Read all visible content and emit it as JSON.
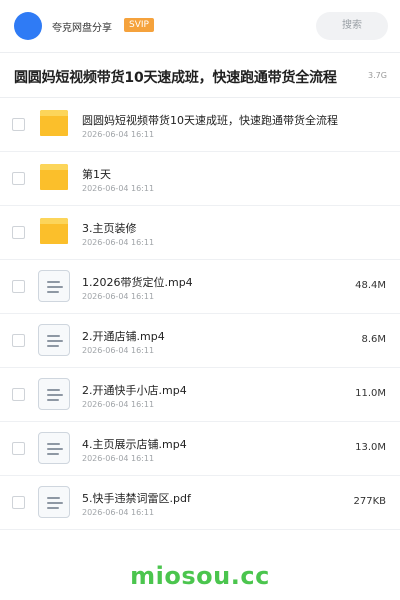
{
  "header": {
    "app_name": "夸克网盘分享",
    "badge": "SVIP",
    "search_label": "搜索"
  },
  "share": {
    "title": "圆圆妈短视频带货10天速成班，快速跑通带货全流程",
    "total_size": "3.7G"
  },
  "files": [
    {
      "type": "folder",
      "name": "圆圆妈短视频带货10天速成班，快速跑通带货全流程",
      "date": "2026-06-04 16:11",
      "size": ""
    },
    {
      "type": "folder",
      "name": "第1天",
      "date": "2026-06-04 16:11",
      "size": ""
    },
    {
      "type": "folder",
      "name": "3.主页装修",
      "date": "2026-06-04 16:11",
      "size": ""
    },
    {
      "type": "file",
      "name": "1.2026带货定位.mp4",
      "date": "2026-06-04 16:11",
      "size": "48.4M"
    },
    {
      "type": "file",
      "name": "2.开通店铺.mp4",
      "date": "2026-06-04 16:11",
      "size": "8.6M"
    },
    {
      "type": "file",
      "name": "2.开通快手小店.mp4",
      "date": "2026-06-04 16:11",
      "size": "11.0M"
    },
    {
      "type": "file",
      "name": "4.主页展示店铺.mp4",
      "date": "2026-06-04 16:11",
      "size": "13.0M"
    },
    {
      "type": "file",
      "name": "5.快手违禁词雷区.pdf",
      "date": "2026-06-04 16:11",
      "size": "277KB"
    }
  ],
  "watermark": "miosou.cc",
  "colors": {
    "accent": "#2f7bf5",
    "svip": "#f5a23c",
    "folder": "#fbbf2b",
    "watermark": "#4bc54e"
  }
}
